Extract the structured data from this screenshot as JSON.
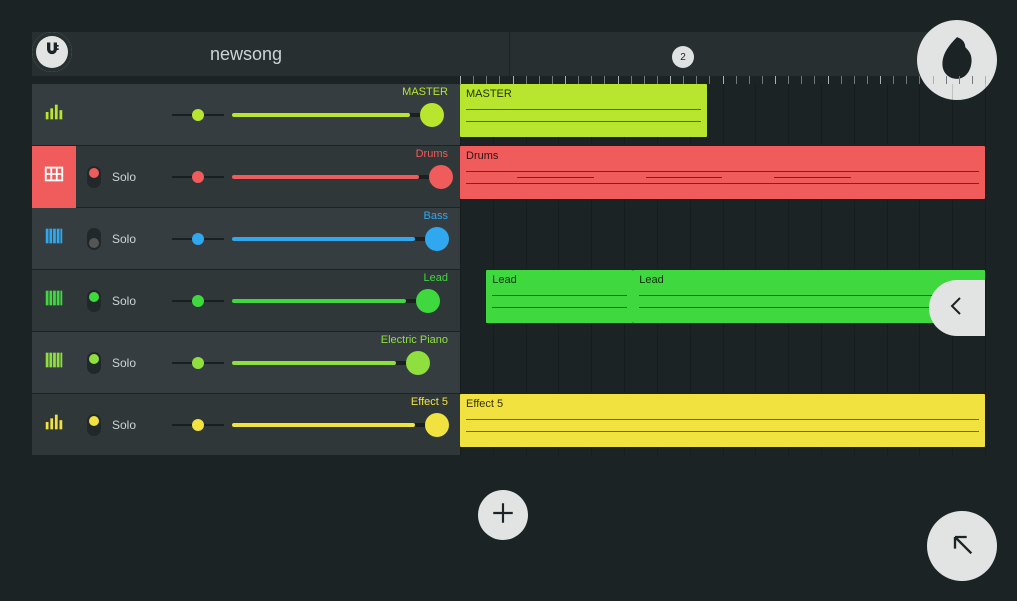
{
  "header": {
    "title": "newsong",
    "marker": "2"
  },
  "colors": {
    "master": "#b8e62e",
    "drums": "#f05b5b",
    "bass": "#2fa8ef",
    "lead": "#3fd93f",
    "piano": "#8fe03f",
    "effect": "#f2e23f"
  },
  "tracks": [
    {
      "name": "MASTER",
      "icon": "mixer",
      "solo": "",
      "muteOn": false,
      "color": "master",
      "pan": 50,
      "vol": 88,
      "alt": false,
      "sel": false
    },
    {
      "name": "Drums",
      "icon": "grid",
      "solo": "Solo",
      "muteOn": true,
      "color": "drums",
      "pan": 50,
      "vol": 92,
      "alt": true,
      "sel": true
    },
    {
      "name": "Bass",
      "icon": "keys",
      "solo": "Solo",
      "muteOn": false,
      "color": "bass",
      "pan": 50,
      "vol": 90,
      "alt": false,
      "sel": false
    },
    {
      "name": "Lead",
      "icon": "keys",
      "solo": "Solo",
      "muteOn": true,
      "color": "lead",
      "pan": 50,
      "vol": 86,
      "alt": true,
      "sel": false
    },
    {
      "name": "Electric Piano",
      "icon": "keys",
      "solo": "Solo",
      "muteOn": true,
      "color": "piano",
      "pan": 50,
      "vol": 82,
      "alt": false,
      "sel": false
    },
    {
      "name": "Effect 5",
      "icon": "mixer",
      "solo": "Solo",
      "muteOn": true,
      "color": "effect",
      "pan": 50,
      "vol": 90,
      "alt": true,
      "sel": false
    }
  ],
  "clips": [
    {
      "track": 0,
      "start": 0,
      "end": 47,
      "label": "MASTER",
      "color": "master"
    },
    {
      "track": 1,
      "start": 0,
      "end": 100,
      "label": "Drums",
      "color": "drums"
    },
    {
      "track": 3,
      "start": 5,
      "end": 33,
      "label": "Lead",
      "color": "lead"
    },
    {
      "track": 3,
      "start": 33,
      "end": 100,
      "label": "Lead",
      "color": "lead"
    },
    {
      "track": 5,
      "start": 0,
      "end": 100,
      "label": "Effect 5",
      "color": "effect"
    }
  ],
  "labels": {
    "solo": "Solo"
  }
}
